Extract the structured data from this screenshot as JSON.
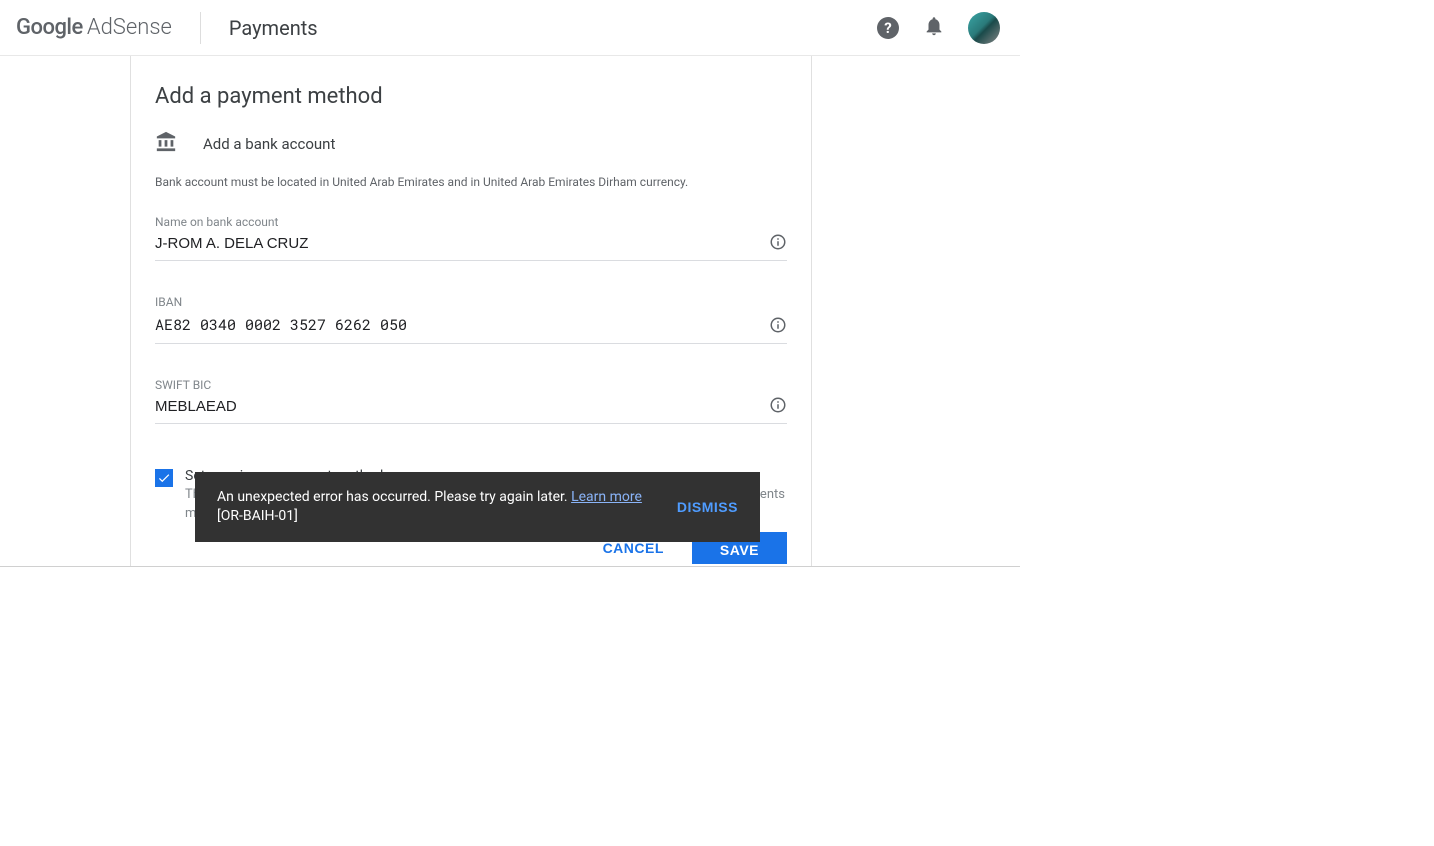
{
  "header": {
    "logo_google": "Google",
    "logo_adsense": "AdSense",
    "page_title": "Payments"
  },
  "card": {
    "title": "Add a payment method",
    "subtitle": "Add a bank account",
    "note": "Bank account must be located in United Arab Emirates and in United Arab Emirates Dirham currency.",
    "fields": {
      "name": {
        "label": "Name on bank account",
        "value": "J-ROM A. DELA CRUZ"
      },
      "iban": {
        "label": "IBAN",
        "value": "AE82 0340 0002 3527 6262 050"
      },
      "swift": {
        "label": "SWIFT BIC",
        "value": "MEBLAEAD"
      }
    },
    "checkbox": {
      "title": "Set as primary payment method",
      "desc": "This payment method may need to be verified. If you make this your primary payment method, payments ma",
      "checked": true
    },
    "actions": {
      "cancel": "CANCEL",
      "save": "SAVE"
    }
  },
  "toast": {
    "message": "An unexpected error has occurred. Please try again later. ",
    "learn_more": "Learn more",
    "code": "[OR-BAIH-01]",
    "dismiss": "DISMISS"
  }
}
